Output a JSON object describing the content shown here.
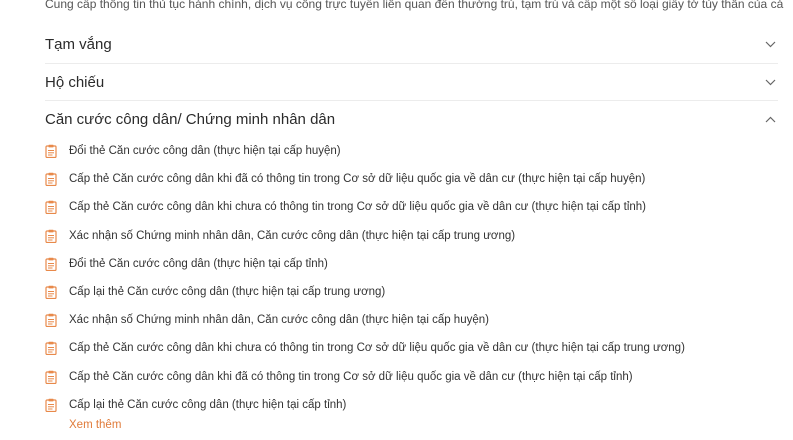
{
  "intro": "Cung cấp thông tin thủ tục hành chính, dịch vụ công trực tuyến liên quan đến thường trú, tạm trú và cấp một số loại giấy tờ tùy thân của cá nhân.",
  "sections": [
    {
      "title": "Tạm vắng",
      "expanded": false
    },
    {
      "title": "Hộ chiếu",
      "expanded": false
    },
    {
      "title": "Căn cước công dân/ Chứng minh nhân dân",
      "expanded": true
    }
  ],
  "items": [
    "Đổi thẻ Căn cước công dân (thực hiện tại cấp huyện)",
    "Cấp thẻ Căn cước công dân khi đã có thông tin trong Cơ sở dữ liệu quốc gia về dân cư (thực hiện tại cấp huyện)",
    "Cấp thẻ Căn cước công dân khi chưa có thông tin trong Cơ sở dữ liệu quốc gia về dân cư (thực hiện tại cấp tỉnh)",
    "Xác nhận số Chứng minh nhân dân, Căn cước công dân (thực hiện tại cấp trung ương)",
    "Đổi thẻ Căn cước công dân (thực hiện tại cấp tỉnh)",
    "Cấp lại thẻ Căn cước công dân (thực hiện tại cấp trung ương)",
    "Xác nhận số Chứng minh nhân dân, Căn cước công dân (thực hiện tại cấp huyện)",
    "Cấp thẻ Căn cước công dân khi chưa có thông tin trong Cơ sở dữ liệu quốc gia về dân cư (thực hiện tại cấp trung ương)",
    "Cấp thẻ Căn cước công dân khi đã có thông tin trong Cơ sở dữ liệu quốc gia về dân cư (thực hiện tại cấp tỉnh)",
    "Cấp lại thẻ Căn cước công dân (thực hiện tại cấp tỉnh)"
  ],
  "more_label": "Xem thêm",
  "colors": {
    "accent": "#e07b3a",
    "icon": "#e8894a"
  }
}
